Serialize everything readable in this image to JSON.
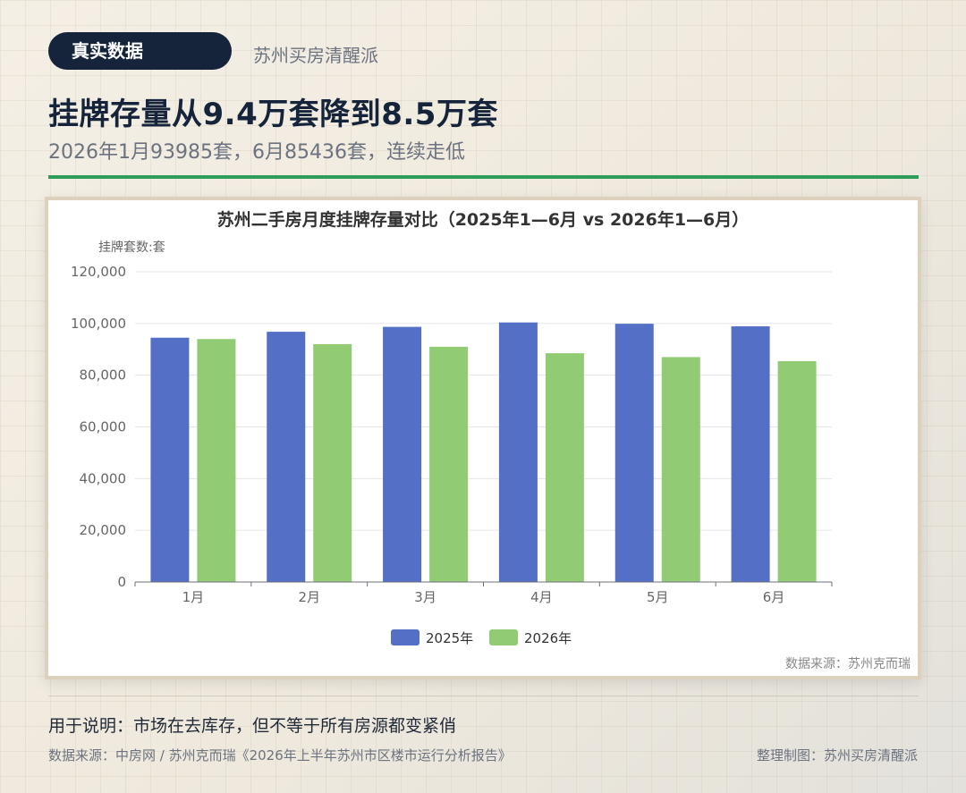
{
  "badge": "真实数据",
  "brand": "苏州买房清醒派",
  "headline": "挂牌存量从9.4万套降到8.5万套",
  "subhead": "2026年1月93985套，6月85436套，连续走低",
  "chart_data": {
    "type": "bar",
    "title": "苏州二手房月度挂牌存量对比（2025年1—6月 vs 2026年1—6月）",
    "ylabel": "挂牌套数:套",
    "categories": [
      "1月",
      "2月",
      "3月",
      "4月",
      "5月",
      "6月"
    ],
    "y_ticks": [
      "0",
      "20,000",
      "40,000",
      "60,000",
      "80,000",
      "100,000",
      "120,000"
    ],
    "ylim": [
      0,
      120000
    ],
    "series": [
      {
        "name": "2025年",
        "color": "#5470c6",
        "values": [
          94500,
          96800,
          98700,
          100400,
          99900,
          98900
        ]
      },
      {
        "name": "2026年",
        "color": "#91cc75",
        "values": [
          93985,
          92000,
          91000,
          88500,
          87000,
          85436
        ]
      }
    ],
    "legend": "bottom-center",
    "grid": true,
    "source": "数据来源：苏州克而瑞"
  },
  "footer": {
    "note": "用于说明：市场在去库存，但不等于所有房源都变紧俏",
    "source": "数据来源：中房网 / 苏州克而瑞《2026年上半年苏州市区楼市运行分析报告》",
    "maker": "整理制图：苏州买房清醒派"
  }
}
